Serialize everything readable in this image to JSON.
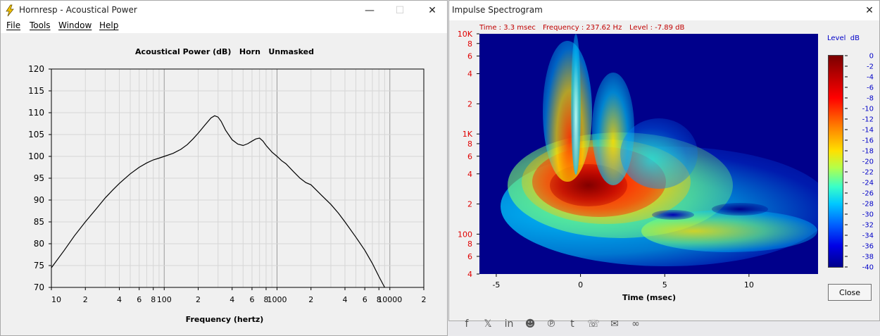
{
  "left_window": {
    "title": "Hornresp - Acoustical Power",
    "menu": [
      "File",
      "Tools",
      "Window",
      "Help"
    ],
    "chart_title": "Acoustical Power (dB)   Horn   Unmasked",
    "x_axis_label": "Frequency (hertz)"
  },
  "right_window": {
    "title": "Impulse Spectrogram",
    "readout": {
      "time": "Time : 3.3 msec",
      "frequency": "Frequency : 237.62 Hz",
      "level": "Level : -7.89 dB"
    },
    "x_axis_label": "Time (msec)",
    "x_ticks": [
      "-5",
      "0",
      "5",
      "10"
    ],
    "y_tick_labels": [
      "10K",
      "8",
      "6",
      "4",
      "2",
      "1K",
      "8",
      "6",
      "4",
      "2",
      "100",
      "8",
      "6",
      "4"
    ],
    "colorbar_title": "Level  dB",
    "colorbar_ticks": [
      "0",
      "-2",
      "-4",
      "-6",
      "-8",
      "-10",
      "-12",
      "-14",
      "-16",
      "-18",
      "-20",
      "-22",
      "-24",
      "-26",
      "-28",
      "-30",
      "-32",
      "-34",
      "-36",
      "-38",
      "-40"
    ],
    "close_label": "Close"
  },
  "taskbar_icons": [
    "facebook-icon",
    "x-icon",
    "linkedin-icon",
    "reddit-icon",
    "pinterest-icon",
    "tumblr-icon",
    "whatsapp-icon",
    "email-icon",
    "link-icon"
  ],
  "chart_data": [
    {
      "type": "line",
      "title": "Acoustical Power (dB)   Horn   Unmasked",
      "xlabel": "Frequency (hertz)",
      "ylabel": "",
      "x_scale": "log",
      "xlim": [
        10,
        20000
      ],
      "ylim": [
        70,
        120
      ],
      "y_ticks": [
        70,
        75,
        80,
        85,
        90,
        95,
        100,
        105,
        110,
        115,
        120
      ],
      "x_tick_labels": [
        {
          "value": 10,
          "label": "10"
        },
        {
          "value": 20,
          "label": "2"
        },
        {
          "value": 40,
          "label": "4"
        },
        {
          "value": 60,
          "label": "6"
        },
        {
          "value": 80,
          "label": "8"
        },
        {
          "value": 100,
          "label": "100"
        },
        {
          "value": 200,
          "label": "2"
        },
        {
          "value": 400,
          "label": "4"
        },
        {
          "value": 600,
          "label": "6"
        },
        {
          "value": 800,
          "label": "8"
        },
        {
          "value": 1000,
          "label": "1000"
        },
        {
          "value": 2000,
          "label": "2"
        },
        {
          "value": 4000,
          "label": "4"
        },
        {
          "value": 6000,
          "label": "6"
        },
        {
          "value": 8000,
          "label": "8"
        },
        {
          "value": 10000,
          "label": "10000"
        },
        {
          "value": 20000,
          "label": "2"
        }
      ],
      "grid": true,
      "series": [
        {
          "x": [
            10,
            13,
            16,
            20,
            25,
            30,
            35,
            40,
            50,
            60,
            70,
            80,
            90,
            100,
            120,
            140,
            160,
            180,
            200,
            230,
            260,
            280,
            300,
            320,
            350,
            400,
            450,
            500,
            550,
            600,
            650,
            700,
            750,
            800,
            900,
            1000,
            1100,
            1200,
            1400,
            1600,
            1800,
            2000,
            2500,
            3000,
            3500,
            4000,
            5000,
            6000,
            7000,
            8000,
            9000
          ],
          "y": [
            74.5,
            78.5,
            81.8,
            85.0,
            88.0,
            90.5,
            92.3,
            93.8,
            96.0,
            97.5,
            98.5,
            99.2,
            99.6,
            100.0,
            100.7,
            101.6,
            102.7,
            104.0,
            105.3,
            107.2,
            108.8,
            109.3,
            109.0,
            108.0,
            106.0,
            103.8,
            102.8,
            102.5,
            102.9,
            103.5,
            104.0,
            104.2,
            103.5,
            102.5,
            101.0,
            100.0,
            99.0,
            98.3,
            96.5,
            95.0,
            94.0,
            93.5,
            91.0,
            89.0,
            87.0,
            85.0,
            81.5,
            78.5,
            75.5,
            72.5,
            69.8
          ]
        }
      ]
    },
    {
      "type": "heatmap",
      "title": "",
      "xlabel": "Time (msec)",
      "ylabel": "",
      "xlim": [
        -6.0,
        14.1
      ],
      "y_scale": "log",
      "ylim": [
        40,
        10000
      ],
      "colorbar": {
        "label": "Level  dB",
        "range": [
          -40,
          0
        ]
      },
      "peak": {
        "time": 0.5,
        "frequency": 260,
        "level": 0
      }
    }
  ]
}
